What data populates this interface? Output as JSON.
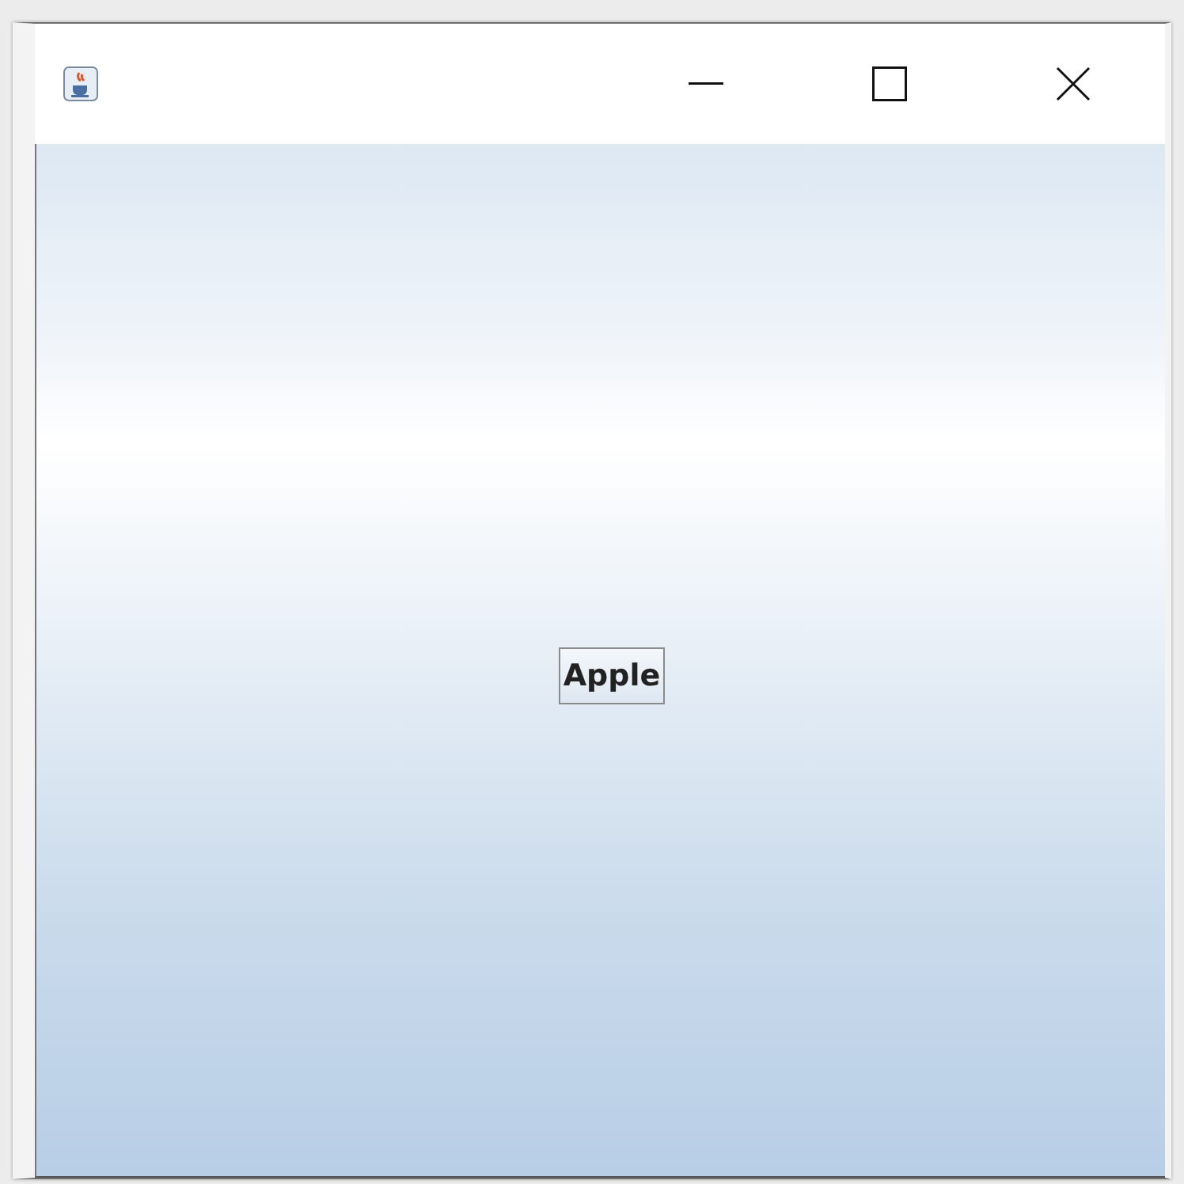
{
  "content": {
    "button": {
      "label": "Apple"
    }
  }
}
